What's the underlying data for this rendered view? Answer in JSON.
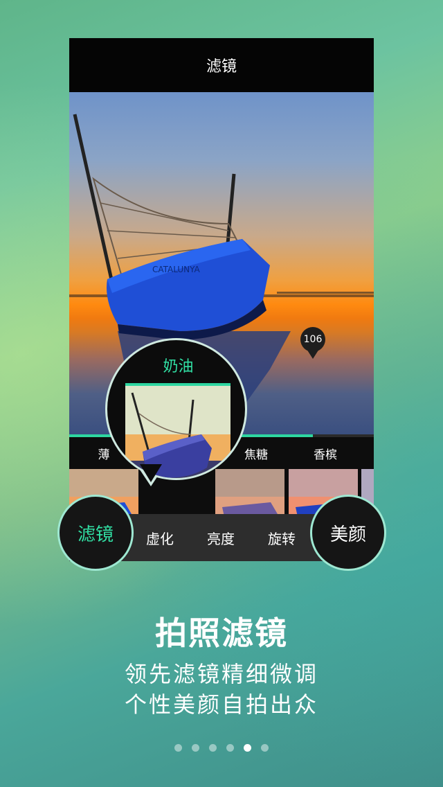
{
  "screen": {
    "title": "滤镜",
    "photo_description_icon": "boat-photo"
  },
  "filter": {
    "selected_name": "奶油",
    "names": [
      "薄",
      "焦糖",
      "香槟"
    ],
    "intensity_value": "106",
    "intensity_fraction": 0.8
  },
  "toolbar": {
    "filter_label": "滤镜",
    "blur_label": "虚化",
    "brightness_label": "亮度",
    "rotate_label": "旋转",
    "beauty_label": "美颜"
  },
  "promo": {
    "headline": "拍照滤镜",
    "line1": "领先滤镜精细微调",
    "line2": "个性美颜自拍出众"
  },
  "pagination": {
    "total": 6,
    "active_index": 4
  },
  "colors": {
    "accent": "#2ed6a0",
    "ring": "#9ee8d2"
  }
}
